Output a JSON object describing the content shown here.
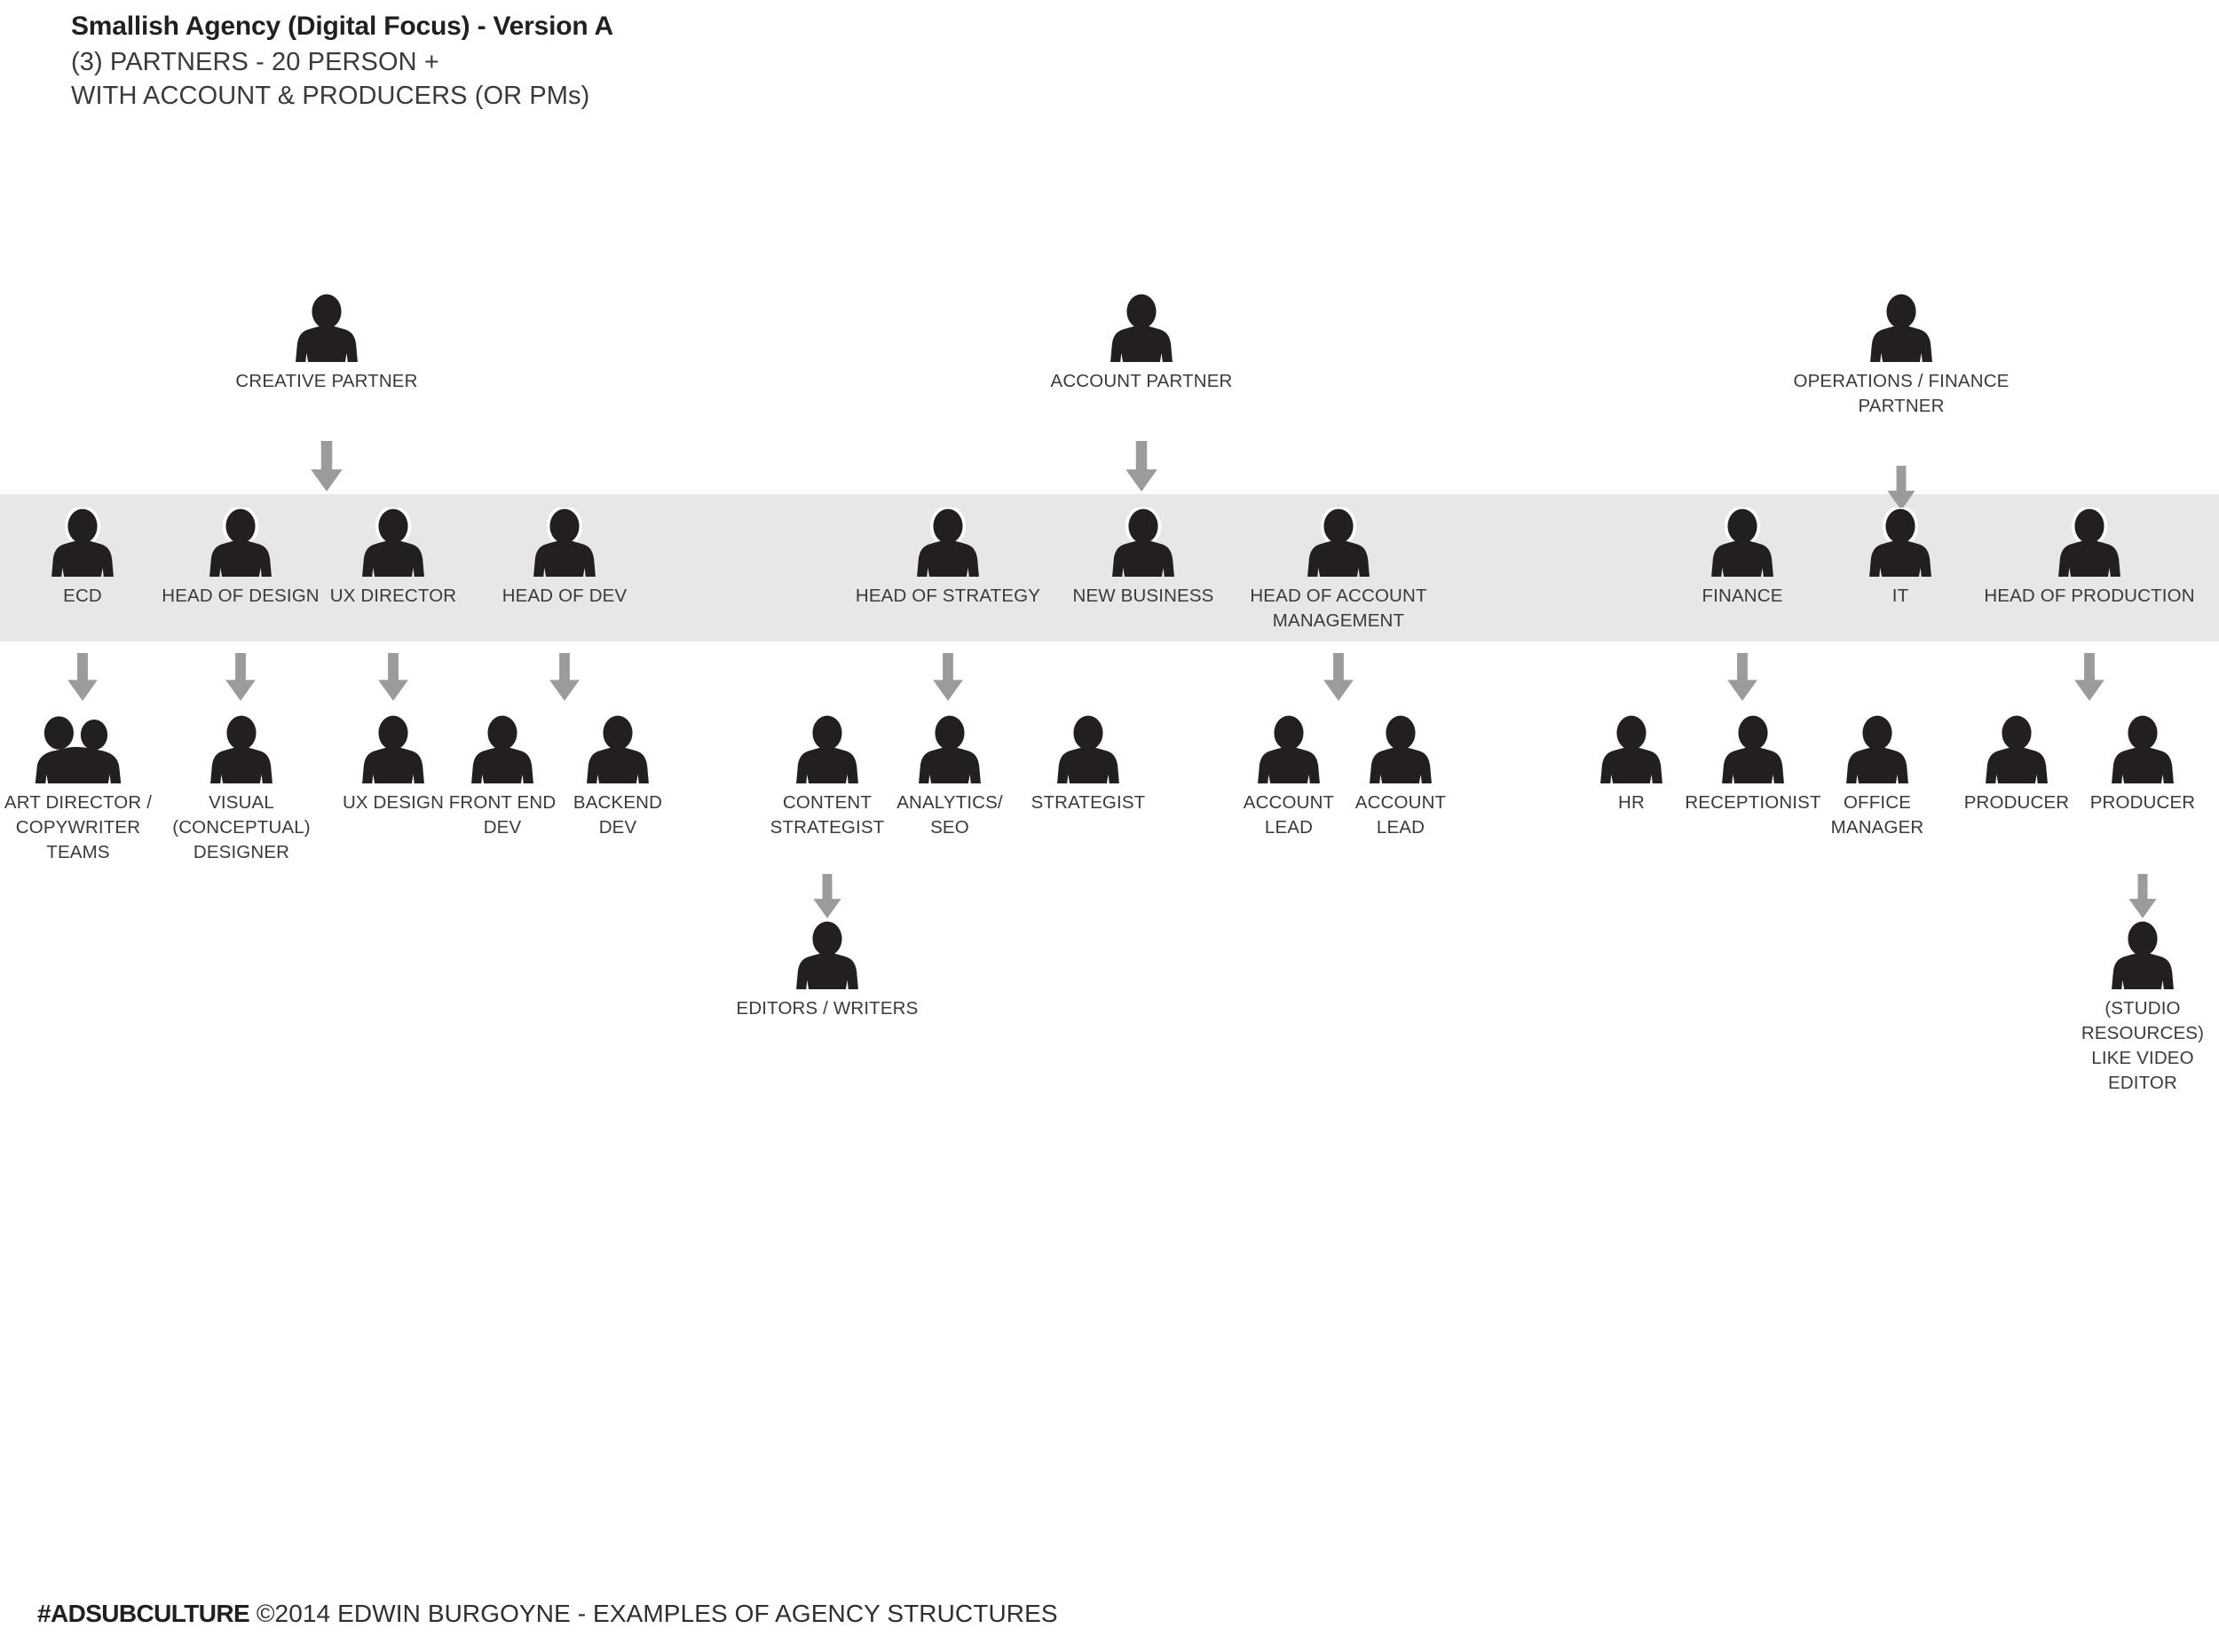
{
  "header": {
    "title": "Smallish Agency (Digital Focus) - Version A",
    "subtitle_line1": "(3) PARTNERS - 20 PERSON +",
    "subtitle_line2": "WITH ACCOUNT & PRODUCERS (OR PMs)"
  },
  "colors": {
    "silhouette": "#231f20",
    "band": "#e7e7e7",
    "arrow": "#9b9b9d",
    "text": "#3a3a3c",
    "page_background": "#ffffff"
  },
  "chart_data": {
    "type": "diagram",
    "title": "Smallish Agency (Digital Focus) - Version A",
    "levels": [
      {
        "name": "partners",
        "nodes": [
          "CREATIVE PARTNER",
          "ACCOUNT PARTNER",
          "OPERATIONS / FINANCE PARTNER"
        ]
      },
      {
        "name": "department-heads",
        "highlighted": true,
        "nodes": [
          "ECD",
          "HEAD OF DESIGN",
          "UX DIRECTOR",
          "HEAD OF DEV",
          "HEAD OF STRATEGY",
          "NEW BUSINESS",
          "HEAD OF ACCOUNT MANAGEMENT",
          "FINANCE",
          "IT",
          "HEAD OF PRODUCTION"
        ]
      },
      {
        "name": "staff",
        "nodes": [
          "ART DIRECTOR / COPYWRITER TEAMS",
          "VISUAL (CONCEPTUAL) DESIGNER",
          "UX DESIGN",
          "FRONT END DEV",
          "BACKEND DEV",
          "CONTENT STRATEGIST",
          "ANALYTICS/ SEO",
          "STRATEGIST",
          "ACCOUNT LEAD",
          "ACCOUNT LEAD",
          "HR",
          "RECEPTIONIST",
          "OFFICE MANAGER",
          "PRODUCER",
          "PRODUCER"
        ]
      },
      {
        "name": "sub-staff",
        "nodes": [
          "EDITORS / WRITERS",
          "(STUDIO RESOURCES) LIKE VIDEO EDITOR"
        ]
      }
    ],
    "edges": [
      {
        "from": "CREATIVE PARTNER",
        "to": "department-heads-creative"
      },
      {
        "from": "ACCOUNT PARTNER",
        "to": "department-heads-account"
      },
      {
        "from": "OPERATIONS / FINANCE PARTNER",
        "to": "department-heads-operations"
      },
      {
        "from": "ECD",
        "to": "ART DIRECTOR / COPYWRITER TEAMS"
      },
      {
        "from": "HEAD OF DESIGN",
        "to": "VISUAL (CONCEPTUAL) DESIGNER"
      },
      {
        "from": "UX DIRECTOR",
        "to": "UX DESIGN"
      },
      {
        "from": "HEAD OF DEV",
        "to": "FRONT END DEV"
      },
      {
        "from": "HEAD OF STRATEGY",
        "to": "CONTENT STRATEGIST"
      },
      {
        "from": "HEAD OF ACCOUNT MANAGEMENT",
        "to": "ACCOUNT LEAD"
      },
      {
        "from": "FINANCE",
        "to": "HR"
      },
      {
        "from": "HEAD OF PRODUCTION",
        "to": "PRODUCER"
      },
      {
        "from": "CONTENT STRATEGIST",
        "to": "EDITORS / WRITERS"
      },
      {
        "from": "PRODUCER",
        "to": "(STUDIO RESOURCES) LIKE VIDEO EDITOR"
      }
    ]
  },
  "partners": [
    {
      "id": "creative-partner",
      "label": "CREATIVE PARTNER",
      "icon": "person-icon"
    },
    {
      "id": "account-partner",
      "label": "ACCOUNT PARTNER",
      "icon": "person-icon"
    },
    {
      "id": "operations-finance-partner",
      "label": "OPERATIONS / FINANCE\nPARTNER",
      "icon": "person-icon"
    }
  ],
  "heads": [
    {
      "id": "ecd",
      "label": "ECD",
      "icon": "person-icon"
    },
    {
      "id": "head-of-design",
      "label": "HEAD OF DESIGN",
      "icon": "person-icon"
    },
    {
      "id": "ux-director",
      "label": "UX DIRECTOR",
      "icon": "person-icon"
    },
    {
      "id": "head-of-dev",
      "label": "HEAD OF DEV",
      "icon": "person-icon"
    },
    {
      "id": "head-of-strategy",
      "label": "HEAD OF STRATEGY",
      "icon": "person-icon"
    },
    {
      "id": "new-business",
      "label": "NEW BUSINESS",
      "icon": "person-icon"
    },
    {
      "id": "head-of-account-management",
      "label": "HEAD OF ACCOUNT\nMANAGEMENT",
      "icon": "person-icon"
    },
    {
      "id": "finance",
      "label": "FINANCE",
      "icon": "person-icon"
    },
    {
      "id": "it",
      "label": "IT",
      "icon": "person-icon"
    },
    {
      "id": "head-of-production",
      "label": "HEAD OF PRODUCTION",
      "icon": "person-icon"
    }
  ],
  "staff": [
    {
      "id": "art-director-copywriter-teams",
      "label": "ART DIRECTOR /\nCOPYWRITER\nTEAMS",
      "icon": "two-person-icon"
    },
    {
      "id": "visual-conceptual-designer",
      "label": "VISUAL\n(CONCEPTUAL)\nDESIGNER",
      "icon": "person-icon"
    },
    {
      "id": "ux-design",
      "label": "UX DESIGN",
      "icon": "person-icon"
    },
    {
      "id": "front-end-dev",
      "label": "FRONT END\nDEV",
      "icon": "person-icon"
    },
    {
      "id": "backend-dev",
      "label": "BACKEND\nDEV",
      "icon": "person-icon"
    },
    {
      "id": "content-strategist",
      "label": "CONTENT\nSTRATEGIST",
      "icon": "person-icon"
    },
    {
      "id": "analytics-seo",
      "label": "ANALYTICS/\nSEO",
      "icon": "person-icon"
    },
    {
      "id": "strategist",
      "label": "STRATEGIST",
      "icon": "person-icon"
    },
    {
      "id": "account-lead-1",
      "label": "ACCOUNT\nLEAD",
      "icon": "person-icon"
    },
    {
      "id": "account-lead-2",
      "label": "ACCOUNT\nLEAD",
      "icon": "person-icon"
    },
    {
      "id": "hr",
      "label": "HR",
      "icon": "person-icon"
    },
    {
      "id": "receptionist",
      "label": "RECEPTIONIST",
      "icon": "person-icon"
    },
    {
      "id": "office-manager",
      "label": "OFFICE\nMANAGER",
      "icon": "person-icon"
    },
    {
      "id": "producer-1",
      "label": "PRODUCER",
      "icon": "person-icon"
    },
    {
      "id": "producer-2",
      "label": "PRODUCER",
      "icon": "person-icon"
    }
  ],
  "substaff": [
    {
      "id": "editors-writers",
      "label": "EDITORS / WRITERS",
      "icon": "person-icon"
    },
    {
      "id": "studio-resources",
      "label": "(STUDIO\nRESOURCES)\nLIKE VIDEO\nEDITOR",
      "icon": "person-icon"
    }
  ],
  "footer": {
    "brand": "#ADSUBCULTURE",
    "credit": "©2014 EDWIN BURGOYNE - EXAMPLES OF AGENCY STRUCTURES"
  }
}
